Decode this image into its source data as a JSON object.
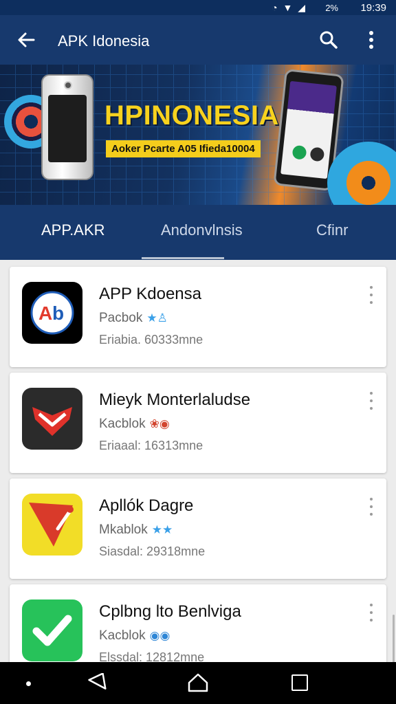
{
  "status_bar": {
    "icons": "◔ ▼ ◢",
    "battery": "2%",
    "time": "19:39"
  },
  "app_bar": {
    "title": "APK Idonesia",
    "back_icon": "arrow-left-icon",
    "search_icon": "search-icon",
    "more_icon": "more-vert-icon"
  },
  "banner": {
    "headline": "HPINONESIA",
    "ribbon": "Aoker Pcarte A05 Ifieda10004"
  },
  "tabs": [
    {
      "label": "APP.AKR",
      "active": true
    },
    {
      "label": "Andonvlnsis",
      "active": false
    },
    {
      "label": "Cfinr",
      "active": false
    }
  ],
  "apps": [
    {
      "name": "APP Kdoensa",
      "meta": "Pacbok",
      "badge": "★♙",
      "sub": "Eriabia. 60333mne",
      "icon": "ab-logo-icon",
      "icon_bg": "#000000"
    },
    {
      "name": "Mieyk Monterlaludse",
      "meta": "Kacblok",
      "badge": "❀◉",
      "sub": "Eriaaal: 16313mne",
      "icon": "red-chevron-icon",
      "icon_bg": "#2b2b2b"
    },
    {
      "name": "Apllók Dagre",
      "meta": "Mkablok",
      "badge": "★★",
      "sub": "Siasdal: 29318mne",
      "icon": "red-triangle-icon",
      "icon_bg": "#f2dd27"
    },
    {
      "name": "Cplbng lto Benlviga",
      "meta": "Kacblok",
      "badge": "◉◉",
      "sub": "Elssdal: 12812mne",
      "icon": "check-icon",
      "icon_bg": "#27c25a"
    }
  ],
  "nav_bar": {
    "back_icon": "nav-back-icon",
    "home_icon": "home-icon",
    "recents_icon": "recents-icon"
  }
}
